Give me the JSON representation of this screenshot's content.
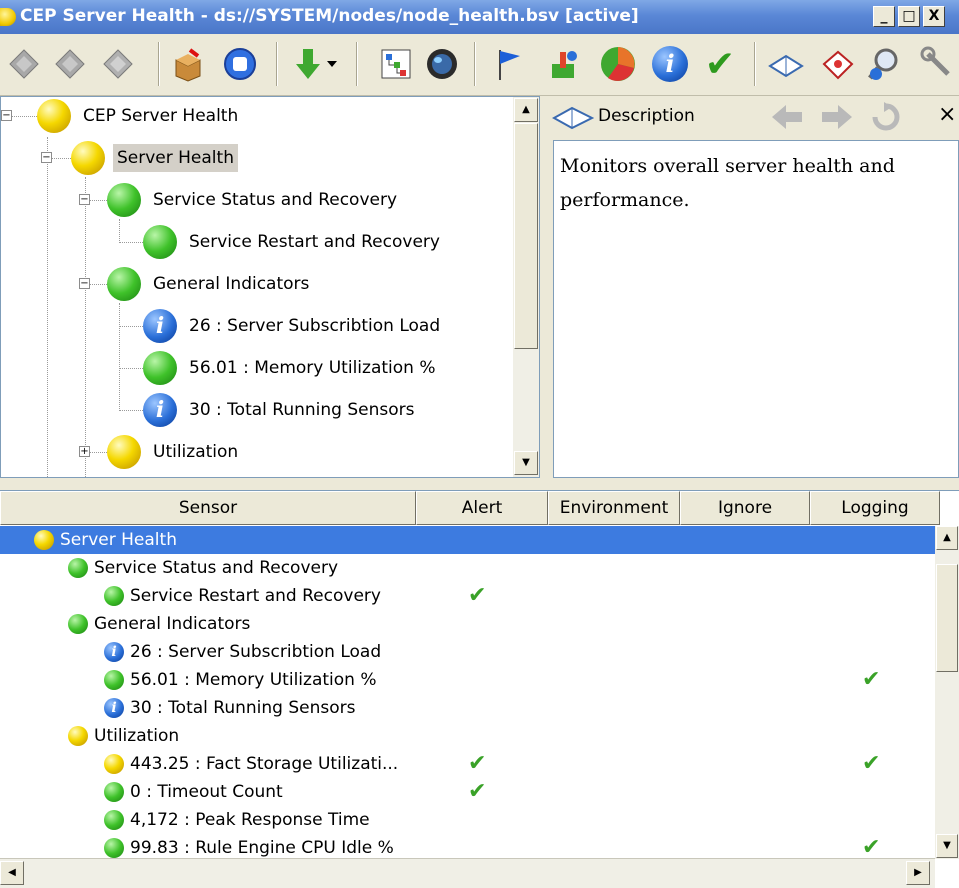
{
  "window": {
    "title": "CEP Server Health - ds://SYSTEM/nodes/node_health.bsv [active]",
    "minimize": "_",
    "maximize": "□",
    "close": "X"
  },
  "tree": {
    "nodes": [
      {
        "label": "CEP Server Health",
        "status": "yellow"
      },
      {
        "label": "Server Health",
        "status": "yellow"
      },
      {
        "label": "Service Status and Recovery",
        "status": "green"
      },
      {
        "label": "Service Restart and Recovery",
        "status": "green"
      },
      {
        "label": "General Indicators",
        "status": "green"
      },
      {
        "label": "26 : Server Subscribtion Load",
        "status": "info"
      },
      {
        "label": "56.01 : Memory Utilization %",
        "status": "green"
      },
      {
        "label": "30 : Total Running Sensors",
        "status": "info"
      },
      {
        "label": "Utilization",
        "status": "yellow"
      }
    ]
  },
  "description": {
    "title": "Description",
    "close": "×",
    "text": "Monitors overall server health and performance."
  },
  "grid": {
    "columns": [
      "Sensor",
      "Alert",
      "Environment",
      "Ignore",
      "Logging"
    ],
    "rows": [
      {
        "label": "Server Health",
        "status": "yellow",
        "alert": false,
        "logging": false
      },
      {
        "label": "Service Status and Recovery",
        "status": "green",
        "alert": false,
        "logging": false
      },
      {
        "label": "Service Restart and Recovery",
        "status": "green",
        "alert": true,
        "logging": false
      },
      {
        "label": "General Indicators",
        "status": "green",
        "alert": false,
        "logging": false
      },
      {
        "label": "26 : Server Subscribtion Load",
        "status": "info",
        "alert": false,
        "logging": false
      },
      {
        "label": "56.01 : Memory Utilization %",
        "status": "green",
        "alert": false,
        "logging": true
      },
      {
        "label": "30 : Total Running Sensors",
        "status": "info",
        "alert": false,
        "logging": false
      },
      {
        "label": "Utilization",
        "status": "yellow",
        "alert": false,
        "logging": false
      },
      {
        "label": "443.25 : Fact Storage Utilizati...",
        "status": "yellow",
        "alert": true,
        "logging": true
      },
      {
        "label": "0 : Timeout Count",
        "status": "green",
        "alert": true,
        "logging": false
      },
      {
        "label": "4,172 : Peak Response Time",
        "status": "green",
        "alert": false,
        "logging": false
      },
      {
        "label": "99.83 : Rule Engine CPU Idle %",
        "status": "green",
        "alert": false,
        "logging": true
      }
    ]
  },
  "icons": {
    "info_glyph": "i",
    "check_glyph": "✔"
  }
}
